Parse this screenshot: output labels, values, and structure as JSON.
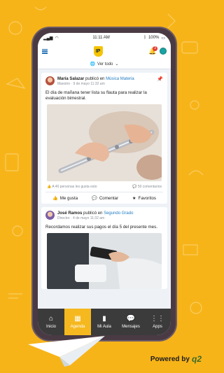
{
  "status": {
    "time": "11:11 AM",
    "battery": "100%"
  },
  "appbar": {
    "logo": "IP",
    "notifications": "3"
  },
  "filter": {
    "label": "Ver todo"
  },
  "posts": [
    {
      "author": "María Salazar",
      "verb": "publicó en",
      "group": "Música Materia",
      "role": "Maestro",
      "date": "9 de mayo 11:32 am",
      "text": "El día de mañana tener lista su flauta para realizar la evaluación bimestral.",
      "likes": "A 40 personas les gusta esto",
      "comments": "50 comentarios"
    },
    {
      "author": "José Ramos",
      "verb": "publicó en",
      "group": "Segundo Grado",
      "role": "Director",
      "date": "4 de mayo 11:32 am",
      "text": "Recordamos realizar sus pagos el día 5 del presente mes."
    }
  ],
  "actions": {
    "like": "Me gusta",
    "comment": "Comentar",
    "fav": "Favoritos"
  },
  "tabs": [
    {
      "label": "Inicio",
      "icon": "home-icon"
    },
    {
      "label": "Agenda",
      "icon": "calendar-icon"
    },
    {
      "label": "Mi Aula",
      "icon": "book-icon"
    },
    {
      "label": "Mensajes",
      "icon": "chat-icon"
    },
    {
      "label": "Apps",
      "icon": "apps-icon"
    }
  ],
  "footer": {
    "powered": "Powered by",
    "brand": "q2"
  },
  "colors": {
    "background": "#f7b419",
    "accent": "#1f7bc0",
    "tab_active": "#f5b81f"
  }
}
